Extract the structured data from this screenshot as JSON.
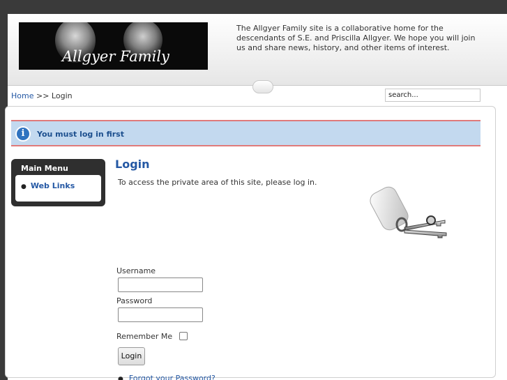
{
  "header": {
    "logo_text": "Allgyer Family",
    "tagline": "The Allgyer Family site is a collaborative home for the descendants of S.E. and Priscilla Allgyer. We hope you will join us and share news, history, and other items of interest."
  },
  "breadcrumb": {
    "home": "Home",
    "separator": ">>",
    "current": "Login"
  },
  "search": {
    "value": "search..."
  },
  "message": {
    "icon": "info-icon",
    "text": "You must log in first"
  },
  "main_menu": {
    "title": "Main Menu",
    "items": [
      {
        "label": "Web Links"
      }
    ]
  },
  "login": {
    "title": "Login",
    "description": "To access the private area of this site, please log in.",
    "username_label": "Username",
    "password_label": "Password",
    "remember_label": "Remember Me",
    "button_label": "Login",
    "forgot_link": "Forgot your Password?"
  },
  "colors": {
    "link": "#2458a4",
    "message_bg": "#c3d9ef",
    "message_border": "#e07a7a",
    "menu_bg": "#2f2f2f"
  }
}
